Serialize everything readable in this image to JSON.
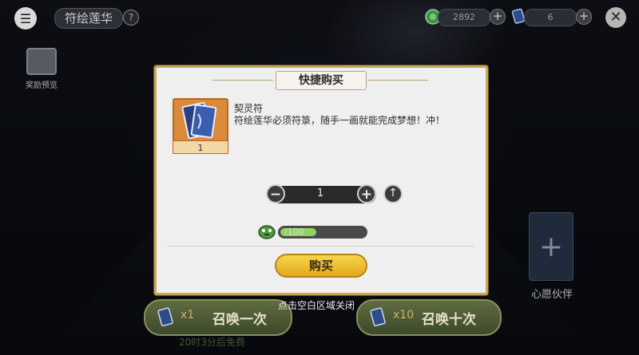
{
  "top_bar": {
    "title": "符绘莲华",
    "help_label": "?",
    "resource1_value": "2892",
    "resource2_value": "6",
    "close_label": "✕"
  },
  "sidebar": {
    "reward_preview_label": "奖励预览"
  },
  "wish_partner": {
    "plus_label": "+",
    "label": "心愿伙伴"
  },
  "summon": {
    "once_count": "x1",
    "once_label": "召唤一次",
    "ten_count": "x10",
    "ten_label": "召唤十次",
    "free_text": "20时3分后免费"
  },
  "modal": {
    "title": "快捷购买",
    "item_name": "契灵符",
    "item_desc": "符绘莲华必须符箓，随手一画就能完成梦想！冲！",
    "item_count": "1",
    "quantity": "1",
    "cost_text": "/100",
    "cost_fill_ratio": 0.42,
    "buy_label": "购买",
    "minus_label": "−",
    "plus_label": "+",
    "max_label": "↑"
  },
  "close_hint": "点击空白区域关闭",
  "colors": {
    "modal_border": "#c9a55a",
    "buy_button": "#f0c033",
    "cost_fill": "#8fd25d"
  }
}
